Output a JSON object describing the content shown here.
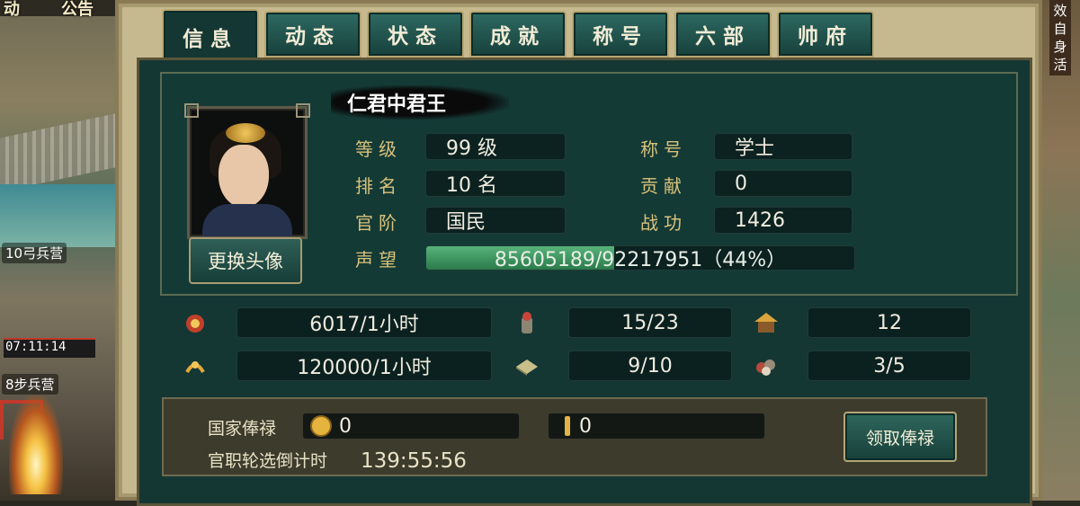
{
  "left_strip": {
    "top_text_1": "动",
    "top_text_2": "公告",
    "building_1": "10弓兵营",
    "timer": "07:11:14",
    "building_2": "8步兵营"
  },
  "right_strip": {
    "text": "效\n自\n身\n活"
  },
  "tabs": [
    {
      "label": "信息",
      "active": true
    },
    {
      "label": "动态"
    },
    {
      "label": "状态"
    },
    {
      "label": "成就"
    },
    {
      "label": "称号"
    },
    {
      "label": "六部"
    },
    {
      "label": "帅府"
    }
  ],
  "profile": {
    "name": "仁君中君王",
    "change_avatar_label": "更换头像",
    "level_label": "等级",
    "level_value": "99 级",
    "rank_label": "排名",
    "rank_value": "10 名",
    "official_label": "官阶",
    "official_value": "国民",
    "title_label": "称号",
    "title_value": "学士",
    "contribution_label": "贡献",
    "contribution_value": "0",
    "merit_label": "战功",
    "merit_value": "1426",
    "fame_label": "声望",
    "fame_text": "85605189/92217951（44%）",
    "fame_fraction": 0.44
  },
  "resources": {
    "row1": [
      "6017/1小时",
      "15/23",
      "12"
    ],
    "row2": [
      "120000/1小时",
      "9/10",
      "3/5"
    ],
    "icons": [
      "coin-bag-icon",
      "soldier-icon",
      "house-icon",
      "grain-icon",
      "book-icon",
      "ore-icon"
    ]
  },
  "salary": {
    "label": "国家俸禄",
    "coin_value": "0",
    "grain_value": "0",
    "claim_label": "领取俸禄",
    "countdown_label": "官职轮选倒计时",
    "countdown_value": "139:55:56"
  },
  "colors": {
    "panel_bg": "#143734",
    "label_gold": "#d8c27a",
    "fame_green": "#3f9a62"
  }
}
